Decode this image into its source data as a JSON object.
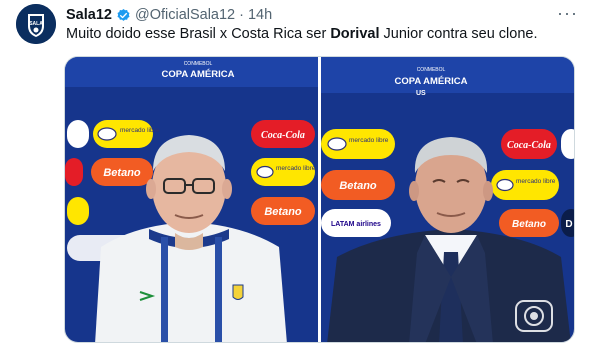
{
  "tweet": {
    "display_name": "Sala12",
    "handle": "@OficialSala12",
    "separator": "·",
    "time": "14h",
    "more_label": "···",
    "text_before": "Muito doido esse Brasil x Costa Rica ser ",
    "text_bold": "Dorival",
    "text_after": " Junior contra seu clone."
  },
  "avatar": {
    "label": "SALA",
    "bg": "#0b2e5f"
  },
  "media": {
    "left_panel": {
      "event_sub": "CONMEBOL",
      "event": "COPA AMÉRICA",
      "sponsors": [
        "mercado libre",
        "Coca-Cola",
        "Betano",
        "mercado libre",
        "Betano"
      ]
    },
    "right_panel": {
      "event_sub": "CONMEBOL",
      "event": "COPA AMÉRICA",
      "event_tail": "US",
      "sponsors": [
        "mercado libre",
        "Coca-Cola",
        "Betano",
        "mercado libre",
        "LATAM airlines",
        "Betano",
        "D"
      ]
    },
    "watermark": "globo"
  },
  "colors": {
    "backdrop": "#16358c",
    "mercadolibre": "#ffe600",
    "cocacola": "#e41d27",
    "betano": "#f25c23",
    "verified": "#1d9bf0"
  }
}
